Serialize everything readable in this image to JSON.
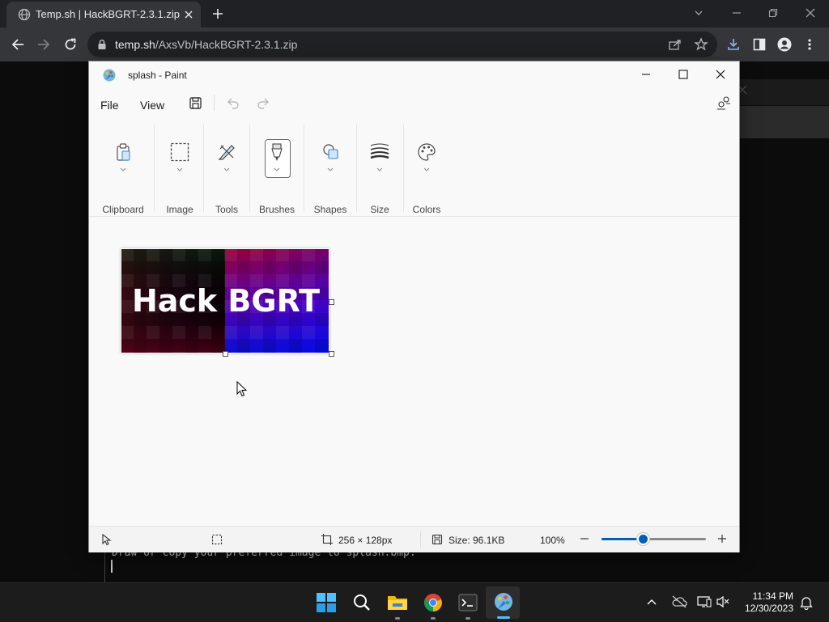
{
  "browser": {
    "tab_title": "Temp.sh | HackBGRT-2.3.1.zip",
    "url_host": "temp.sh",
    "url_path": "/AxsVb/HackBGRT-2.3.1.zip"
  },
  "paint": {
    "window_title": "splash - Paint",
    "menu": {
      "file": "File",
      "view": "View"
    },
    "ribbon": [
      "Clipboard",
      "Image",
      "Tools",
      "Brushes",
      "Shapes",
      "Size",
      "Colors"
    ],
    "image_text": "Hack BGRT",
    "status": {
      "dimensions": "256 × 128px",
      "file_size": "Size: 96.1KB",
      "zoom": "100%",
      "zoom_fraction": 0.4
    }
  },
  "terminal": {
    "text": "Draw or copy your preferred image to splash.bmp."
  },
  "taskbar": {
    "time": "11:34 PM",
    "date": "12/30/2023"
  }
}
